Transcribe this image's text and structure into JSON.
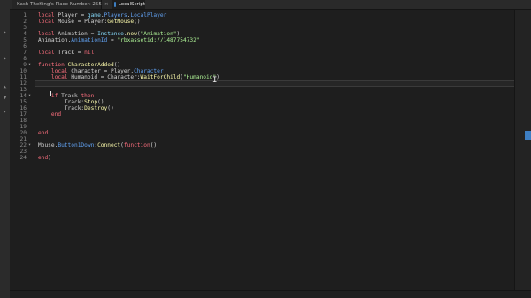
{
  "tabs": [
    {
      "label": "Kash TheKing's Place Number: 255",
      "close": "×",
      "icon_color": "#3ba55d"
    },
    {
      "label": "LocalScript",
      "close": "×",
      "icon_color": "#3d7ec2"
    }
  ],
  "left_strip_marks": [
    "▸",
    "▸",
    "▲",
    "▼",
    "▾"
  ],
  "lines": [
    {
      "num": "1",
      "fold": "",
      "tokens": [
        [
          "kw",
          "local"
        ],
        [
          "t",
          " Player = "
        ],
        [
          "bi",
          "game"
        ],
        [
          "t",
          "."
        ],
        [
          "prop",
          "Players"
        ],
        [
          "t",
          "."
        ],
        [
          "prop",
          "LocalPlayer"
        ]
      ]
    },
    {
      "num": "2",
      "fold": "",
      "tokens": [
        [
          "kw",
          "local"
        ],
        [
          "t",
          " Mouse = Player:"
        ],
        [
          "fn",
          "GetMouse"
        ],
        [
          "t",
          "()"
        ]
      ]
    },
    {
      "num": "3",
      "fold": "",
      "tokens": []
    },
    {
      "num": "4",
      "fold": "",
      "tokens": [
        [
          "kw",
          "local"
        ],
        [
          "t",
          " Animation = "
        ],
        [
          "bi",
          "Instance"
        ],
        [
          "t",
          "."
        ],
        [
          "fn",
          "new"
        ],
        [
          "t",
          "("
        ],
        [
          "str",
          "\"Animation\""
        ],
        [
          "t",
          ")"
        ]
      ]
    },
    {
      "num": "5",
      "fold": "",
      "tokens": [
        [
          "t",
          "Animation."
        ],
        [
          "prop",
          "AnimationId"
        ],
        [
          "t",
          " = "
        ],
        [
          "str",
          "\"rbxassetid://1487754732\""
        ]
      ]
    },
    {
      "num": "6",
      "fold": "",
      "tokens": []
    },
    {
      "num": "7",
      "fold": "",
      "tokens": [
        [
          "kw",
          "local"
        ],
        [
          "t",
          " Track = "
        ],
        [
          "kw",
          "nil"
        ]
      ]
    },
    {
      "num": "8",
      "fold": "",
      "tokens": []
    },
    {
      "num": "9",
      "fold": "▾",
      "tokens": [
        [
          "kw",
          "function"
        ],
        [
          "t",
          " "
        ],
        [
          "fn",
          "CharacterAdded"
        ],
        [
          "t",
          "()"
        ]
      ]
    },
    {
      "num": "10",
      "fold": "",
      "tokens": [
        [
          "t",
          "    "
        ],
        [
          "kw",
          "local"
        ],
        [
          "t",
          " Character = Player."
        ],
        [
          "prop",
          "Character"
        ]
      ]
    },
    {
      "num": "11",
      "fold": "",
      "tokens": [
        [
          "t",
          "    "
        ],
        [
          "kw",
          "local"
        ],
        [
          "t",
          " Humanoid = Character:"
        ],
        [
          "fn",
          "WaitForChild"
        ],
        [
          "t",
          "("
        ],
        [
          "str",
          "\"Humanoid\""
        ],
        [
          "t",
          ")"
        ]
      ]
    },
    {
      "num": "12",
      "fold": "",
      "tokens": [
        [
          "t",
          "    "
        ]
      ]
    },
    {
      "num": "13",
      "fold": "",
      "tokens": []
    },
    {
      "num": "14",
      "fold": "▾",
      "tokens": [
        [
          "t",
          "    "
        ],
        [
          "kw",
          "if"
        ],
        [
          "t",
          " Track "
        ],
        [
          "kw",
          "then"
        ]
      ]
    },
    {
      "num": "15",
      "fold": "",
      "tokens": [
        [
          "t",
          "        Track:"
        ],
        [
          "fn",
          "Stop"
        ],
        [
          "t",
          "()"
        ]
      ]
    },
    {
      "num": "16",
      "fold": "",
      "tokens": [
        [
          "t",
          "        Track:"
        ],
        [
          "fn",
          "Destroy"
        ],
        [
          "t",
          "()"
        ]
      ]
    },
    {
      "num": "17",
      "fold": "",
      "tokens": [
        [
          "t",
          "    "
        ],
        [
          "kw",
          "end"
        ]
      ]
    },
    {
      "num": "18",
      "fold": "",
      "tokens": []
    },
    {
      "num": "19",
      "fold": "",
      "tokens": []
    },
    {
      "num": "20",
      "fold": "",
      "tokens": [
        [
          "kw",
          "end"
        ]
      ]
    },
    {
      "num": "21",
      "fold": "",
      "tokens": []
    },
    {
      "num": "22",
      "fold": "▾",
      "tokens": [
        [
          "t",
          "Mouse."
        ],
        [
          "prop",
          "Button1Down"
        ],
        [
          "t",
          ":"
        ],
        [
          "fn",
          "Connect"
        ],
        [
          "t",
          "("
        ],
        [
          "kw",
          "function"
        ],
        [
          "t",
          "()"
        ]
      ]
    },
    {
      "num": "23",
      "fold": "",
      "tokens": []
    },
    {
      "num": "24",
      "fold": "",
      "tokens": [
        [
          "kw",
          "end"
        ],
        [
          "t",
          ")"
        ]
      ]
    }
  ],
  "current_line": 12,
  "mouse_cursor_glyph": "I",
  "colors": {
    "keyword": "#f86d7c",
    "builtin": "#84d6f7",
    "function": "#fdfbac",
    "string": "#adf195",
    "property": "#61a1f1",
    "background": "#1e1e1e"
  }
}
